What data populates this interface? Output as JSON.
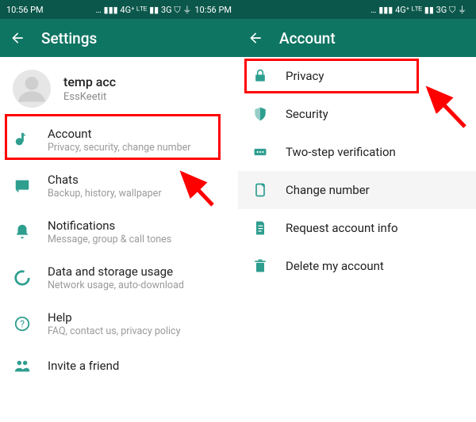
{
  "left": {
    "status": {
      "time_left": "10:56 PM",
      "net": "… ▮▮▮ 4G⁺ ᴸᵀᴱ ▮▮ 3G ⛉ ⏚",
      "time_right": "10:56 PM"
    },
    "appbar_title": "Settings",
    "profile": {
      "name": "temp acc",
      "sub": "EssKeetit"
    },
    "items": [
      {
        "icon": "key",
        "title": "Account",
        "sub": "Privacy, security, change number"
      },
      {
        "icon": "chat",
        "title": "Chats",
        "sub": "Backup, history, wallpaper"
      },
      {
        "icon": "bell",
        "title": "Notifications",
        "sub": "Message, group & call tones"
      },
      {
        "icon": "data",
        "title": "Data and storage usage",
        "sub": "Network usage, auto-download"
      },
      {
        "icon": "help",
        "title": "Help",
        "sub": "FAQ, contact us, privacy policy"
      },
      {
        "icon": "people",
        "title": "Invite a friend",
        "sub": ""
      }
    ]
  },
  "right": {
    "status": {
      "time_left": "",
      "net": "… ▮▮▮ 4G⁺ ᴸᵀᴱ ▮▮ 3G ⛉ ⏚",
      "time_right": ""
    },
    "appbar_title": "Account",
    "items": [
      {
        "icon": "lock",
        "title": "Privacy"
      },
      {
        "icon": "shield",
        "title": "Security"
      },
      {
        "icon": "twostep",
        "title": "Two-step verification"
      },
      {
        "icon": "sim",
        "title": "Change number"
      },
      {
        "icon": "doc",
        "title": "Request account info"
      },
      {
        "icon": "trash",
        "title": "Delete my account"
      }
    ]
  }
}
